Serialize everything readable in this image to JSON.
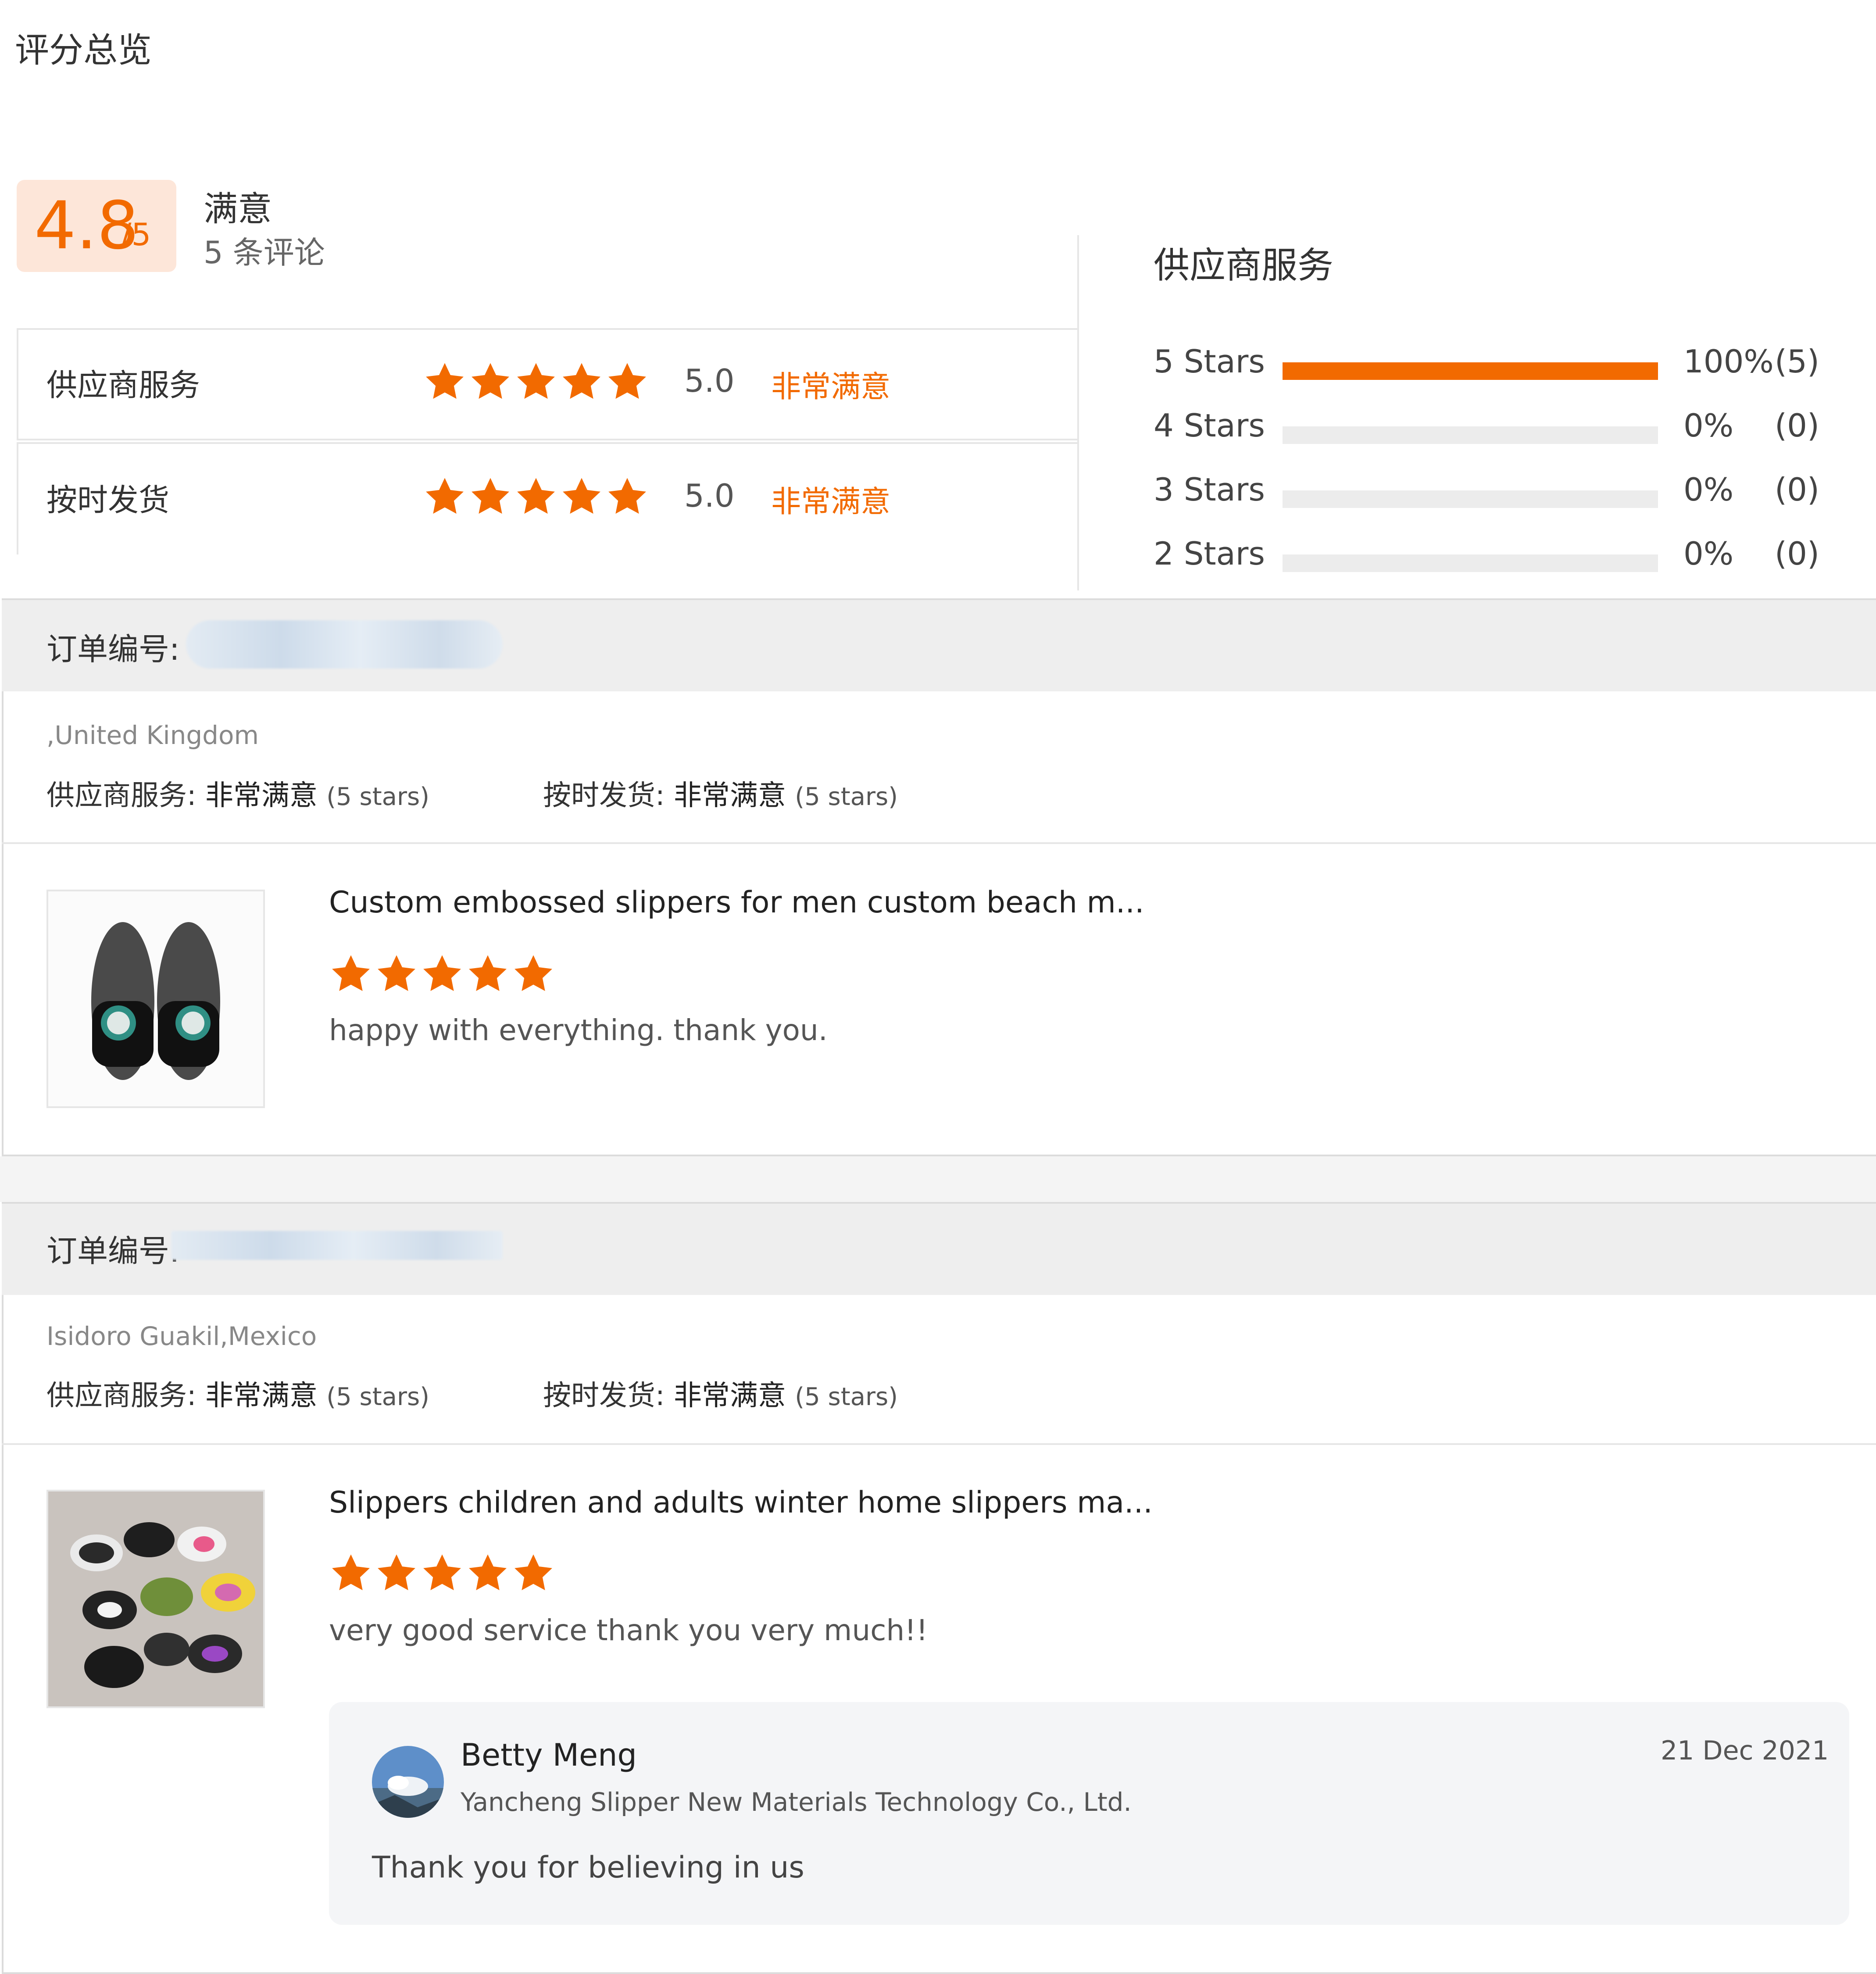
{
  "page_title": "评分总览",
  "overview": {
    "score": "4.8",
    "score_max": "/5",
    "satisfaction": "满意",
    "review_count": "5 条评论",
    "categories": [
      {
        "label": "供应商服务",
        "score": "5.0",
        "level": "非常满意"
      },
      {
        "label": "按时发货",
        "score": "5.0",
        "level": "非常满意"
      }
    ]
  },
  "distribution": {
    "title": "供应商服务",
    "rows": [
      {
        "label": "5  Stars",
        "percent": "100%",
        "count": "(5)",
        "fill": 1.0
      },
      {
        "label": "4  Stars",
        "percent": "0%",
        "count": "(0)",
        "fill": 0
      },
      {
        "label": "3  Stars",
        "percent": "0%",
        "count": "(0)",
        "fill": 0
      },
      {
        "label": "2  Stars",
        "percent": "0%",
        "count": "(0)",
        "fill": 0
      }
    ]
  },
  "reviews": [
    {
      "order_label": "订单编号:",
      "buyer_location": ",United Kingdom",
      "service_label": "供应商服务:",
      "service_level": "非常满意",
      "service_stars": "(5 stars)",
      "delivery_label": "按时发货:",
      "delivery_level": "非常满意",
      "delivery_stars": "(5 stars)",
      "product_title": "Custom embossed slippers for men custom beach m...",
      "rating": 5,
      "comment": "happy with everything. thank you."
    },
    {
      "order_label": "订单编号:",
      "buyer_location": "Isidoro Guakil,Mexico",
      "service_label": "供应商服务:",
      "service_level": "非常满意",
      "service_stars": "(5 stars)",
      "delivery_label": "按时发货:",
      "delivery_level": "非常满意",
      "delivery_stars": "(5 stars)",
      "product_title": "Slippers children and adults winter home slippers ma...",
      "rating": 5,
      "comment": "very good service thank you very much!!",
      "reply": {
        "name": "Betty Meng",
        "company": "Yancheng Slipper New Materials Technology Co., Ltd.",
        "date": "21 Dec 2021",
        "text": "Thank you for believing in us"
      }
    }
  ],
  "colors": {
    "accent": "#f26a00",
    "accent_bg": "#fde6d9",
    "track": "#ececec"
  },
  "icons": {
    "star": "star-icon",
    "avatar": "avatar-icon"
  }
}
